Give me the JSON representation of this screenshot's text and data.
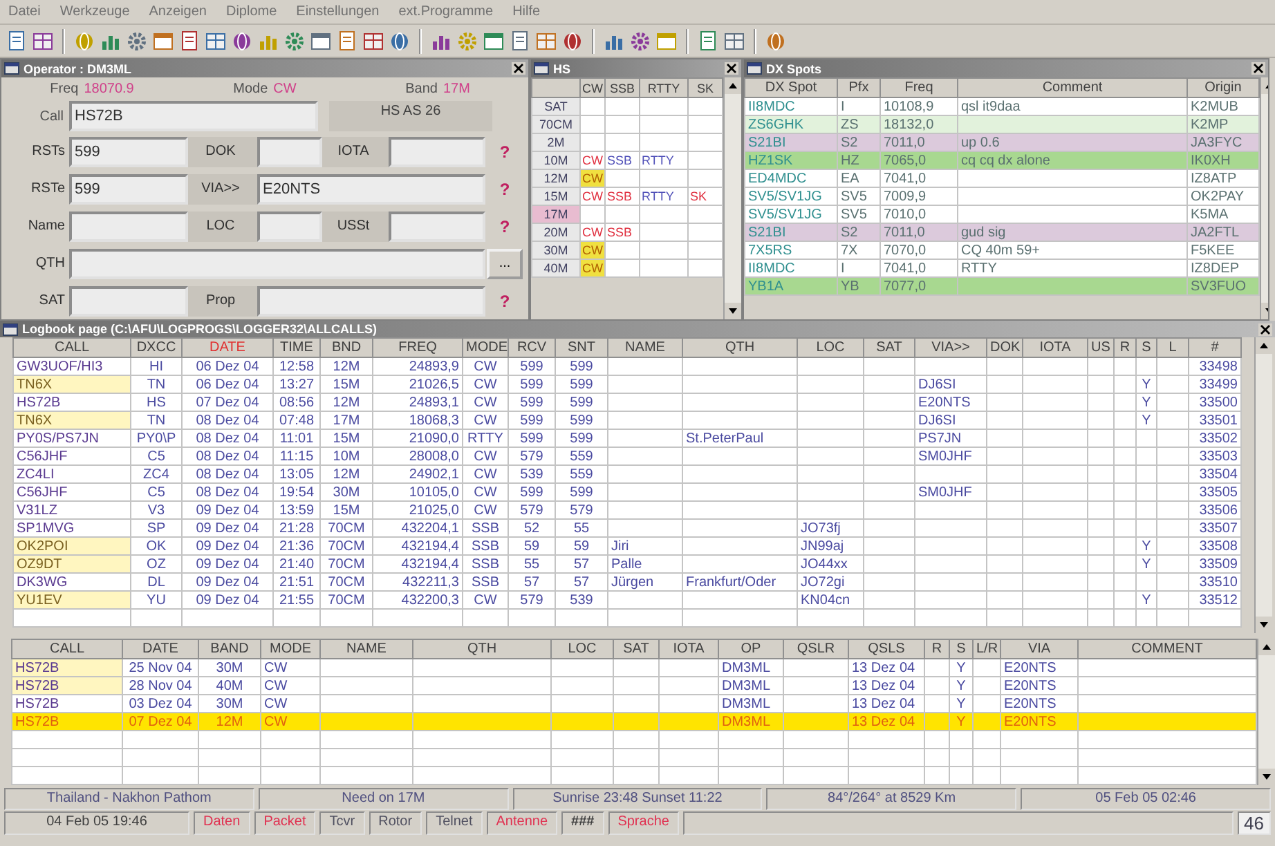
{
  "menu": [
    "Datei",
    "Werkzeuge",
    "Anzeigen",
    "Diplome",
    "Einstellungen",
    "ext.Programme",
    "Hilfe"
  ],
  "operator": {
    "title": "Operator : DM3ML",
    "status": [
      {
        "label": "Freq",
        "value": "18070.9"
      },
      {
        "label": "Mode",
        "value": "CW"
      },
      {
        "label": "Band",
        "value": "17M"
      }
    ],
    "call": {
      "label": "Call",
      "value": "HS72B"
    },
    "info": "HS AS 26",
    "rows": [
      {
        "fields": [
          {
            "label": "RSTs",
            "value": "599"
          },
          {
            "label": "DOK"
          },
          {
            "label": "IOTA"
          }
        ],
        "button": {
          "text": "?",
          "kind": "help"
        }
      },
      {
        "fields": [
          {
            "label": "RSTe",
            "value": "599"
          },
          {
            "label": "VIA>>",
            "value": "E20NTS"
          }
        ],
        "button": {
          "text": "?",
          "kind": "help"
        }
      },
      {
        "fields": [
          {
            "label": "Name"
          },
          {
            "label": "LOC"
          },
          {
            "label": "USSt"
          }
        ],
        "button": {
          "text": "?",
          "kind": "help"
        }
      },
      {
        "fields": [
          {
            "label": "QTH"
          }
        ],
        "button": {
          "text": "...",
          "kind": "browse"
        }
      },
      {
        "fields": [
          {
            "label": "SAT"
          },
          {
            "label": "Prop"
          }
        ],
        "button": {
          "text": "?",
          "kind": "help"
        }
      }
    ]
  },
  "hs": {
    "title": "HS",
    "columns": [
      "CW",
      "SSB",
      "RTTY",
      "SK"
    ],
    "rows": [
      {
        "band": "SAT",
        "selected": false
      },
      {
        "band": "70CM",
        "selected": false
      },
      {
        "band": "2M",
        "selected": false
      },
      {
        "band": "10M",
        "selected": false,
        "cw": {
          "text": "CW",
          "kind": "needed"
        },
        "ssb": {
          "text": "SSB",
          "kind": "worked"
        },
        "rtty": {
          "text": "RTTY",
          "kind": "worked"
        }
      },
      {
        "band": "12M",
        "selected": false,
        "cw": {
          "text": "CW",
          "kind": "confirmed"
        }
      },
      {
        "band": "15M",
        "selected": false,
        "cw": {
          "text": "CW",
          "kind": "needed"
        },
        "ssb": {
          "text": "SSB",
          "kind": "needed"
        },
        "rtty": {
          "text": "RTTY",
          "kind": "worked"
        },
        "psk": {
          "text": "SK",
          "kind": "needed"
        }
      },
      {
        "band": "17M",
        "selected": true
      },
      {
        "band": "20M",
        "selected": false,
        "cw": {
          "text": "CW",
          "kind": "needed"
        },
        "ssb": {
          "text": "SSB",
          "kind": "needed"
        }
      },
      {
        "band": "30M",
        "selected": false,
        "cw": {
          "text": "CW",
          "kind": "confirmed"
        }
      },
      {
        "band": "40M",
        "selected": false,
        "cw": {
          "text": "CW",
          "kind": "confirmed"
        }
      }
    ]
  },
  "dx_spots": {
    "title": "DX Spots",
    "columns": [
      "DX Spot",
      "Pfx",
      "Freq",
      "Comment",
      "Origin"
    ],
    "rows": [
      {
        "spot": "II8MDC",
        "pfx": "I",
        "freq": "10108,9",
        "comment": "qsl it9daa",
        "origin": "K2MUB",
        "color": "#ffffff"
      },
      {
        "spot": "ZS6GHK",
        "pfx": "ZS",
        "freq": "18132,0",
        "origin": "K2MP",
        "color": "#e2f2dc"
      },
      {
        "spot": "S21BI",
        "pfx": "S2",
        "freq": "7011,0",
        "comment": "up 0.6",
        "origin": "JA3FYC",
        "color": "#dccadc"
      },
      {
        "spot": "HZ1SK",
        "pfx": "HZ",
        "freq": "7065,0",
        "comment": "cq cq dx alone",
        "origin": "IK0XH",
        "color": "#a8d890"
      },
      {
        "spot": "ED4MDC",
        "pfx": "EA",
        "freq": "7041,0",
        "origin": "IZ8ATP",
        "color": "#ffffff"
      },
      {
        "spot": "SV5/SV1JG",
        "pfx": "SV5",
        "freq": "7009,9",
        "origin": "OK2PAY",
        "color": "#ffffff"
      },
      {
        "spot": "SV5/SV1JG",
        "pfx": "SV5",
        "freq": "7010,0",
        "origin": "K5MA",
        "color": "#ffffff"
      },
      {
        "spot": "S21BI",
        "pfx": "S2",
        "freq": "7011,0",
        "comment": "gud sig",
        "origin": "JA2FTL",
        "color": "#dccadc"
      },
      {
        "spot": "7X5RS",
        "pfx": "7X",
        "freq": "7070,0",
        "comment": "CQ 40m 59+",
        "origin": "F5KEE",
        "color": "#ffffff"
      },
      {
        "spot": "II8MDC",
        "pfx": "I",
        "freq": "7041,0",
        "comment": "RTTY",
        "origin": "IZ8DEP",
        "color": "#ffffff"
      },
      {
        "spot": "YB1A",
        "pfx": "YB",
        "freq": "7077,0",
        "origin": "SV3FUO",
        "color": "#a8d890"
      }
    ]
  },
  "logbook": {
    "title": "Logbook page (C:\\AFU\\LOGPROGS\\LOGGER32\\ALLCALLS)",
    "columns": [
      {
        "label": "CALL",
        "highlighted": false
      },
      {
        "label": "DXCC",
        "highlighted": false
      },
      {
        "label": "DATE",
        "highlighted": true
      },
      {
        "label": "TIME",
        "highlighted": false
      },
      {
        "label": "BND",
        "highlighted": false
      },
      {
        "label": "FREQ",
        "highlighted": false
      },
      {
        "label": "MODE",
        "highlighted": false
      },
      {
        "label": "RCV",
        "highlighted": false
      },
      {
        "label": "SNT",
        "highlighted": false
      },
      {
        "label": "NAME",
        "highlighted": false
      },
      {
        "label": "QTH",
        "highlighted": false
      },
      {
        "label": "LOC",
        "highlighted": false
      },
      {
        "label": "SAT",
        "highlighted": false
      },
      {
        "label": "VIA>>",
        "highlighted": false
      },
      {
        "label": "DOK",
        "highlighted": false
      },
      {
        "label": "IOTA",
        "highlighted": false
      },
      {
        "label": "US",
        "highlighted": false
      },
      {
        "label": "R",
        "highlighted": false
      },
      {
        "label": "S",
        "highlighted": false
      },
      {
        "label": "L",
        "highlighted": false
      },
      {
        "label": "#",
        "highlighted": false
      }
    ],
    "rows": [
      {
        "highlight": false,
        "call": "GW3UOF/HI3",
        "dxcc": "HI",
        "date": "06 Dez 04",
        "time": "12:58",
        "band": "12M",
        "freq": "24893,9",
        "mode": "CW",
        "rcv": "599",
        "snt": "599",
        "number": "33498"
      },
      {
        "highlight": true,
        "call": "TN6X",
        "dxcc": "TN",
        "date": "06 Dez 04",
        "time": "13:27",
        "band": "15M",
        "freq": "21026,5",
        "mode": "CW",
        "rcv": "599",
        "snt": "599",
        "via": "DJ6SI",
        "s": "Y",
        "number": "33499"
      },
      {
        "highlight": false,
        "call": "HS72B",
        "dxcc": "HS",
        "date": "07 Dez 04",
        "time": "08:56",
        "band": "12M",
        "freq": "24893,1",
        "mode": "CW",
        "rcv": "599",
        "snt": "599",
        "via": "E20NTS",
        "s": "Y",
        "number": "33500"
      },
      {
        "highlight": true,
        "call": "TN6X",
        "dxcc": "TN",
        "date": "08 Dez 04",
        "time": "07:48",
        "band": "17M",
        "freq": "18068,3",
        "mode": "CW",
        "rcv": "599",
        "snt": "599",
        "via": "DJ6SI",
        "s": "Y",
        "number": "33501"
      },
      {
        "highlight": false,
        "call": "PY0S/PS7JN",
        "dxcc": "PY0\\P",
        "date": "08 Dez 04",
        "time": "11:01",
        "band": "15M",
        "freq": "21090,0",
        "mode": "RTTY",
        "rcv": "599",
        "snt": "599",
        "qth": "St.PeterPaul",
        "via": "PS7JN",
        "number": "33502"
      },
      {
        "highlight": false,
        "call": "C56JHF",
        "dxcc": "C5",
        "date": "08 Dez 04",
        "time": "11:15",
        "band": "10M",
        "freq": "28008,0",
        "mode": "CW",
        "rcv": "579",
        "snt": "559",
        "via": "SM0JHF",
        "number": "33503"
      },
      {
        "highlight": false,
        "call": "ZC4LI",
        "dxcc": "ZC4",
        "date": "08 Dez 04",
        "time": "13:05",
        "band": "12M",
        "freq": "24902,1",
        "mode": "CW",
        "rcv": "539",
        "snt": "559",
        "number": "33504"
      },
      {
        "highlight": false,
        "call": "C56JHF",
        "dxcc": "C5",
        "date": "08 Dez 04",
        "time": "19:54",
        "band": "30M",
        "freq": "10105,0",
        "mode": "CW",
        "rcv": "599",
        "snt": "599",
        "via": "SM0JHF",
        "number": "33505"
      },
      {
        "highlight": false,
        "call": "V31LZ",
        "dxcc": "V3",
        "date": "09 Dez 04",
        "time": "13:59",
        "band": "15M",
        "freq": "21025,0",
        "mode": "CW",
        "rcv": "579",
        "snt": "579",
        "number": "33506"
      },
      {
        "highlight": false,
        "call": "SP1MVG",
        "dxcc": "SP",
        "date": "09 Dez 04",
        "time": "21:28",
        "band": "70CM",
        "freq": "432204,1",
        "mode": "SSB",
        "rcv": "52",
        "snt": "55",
        "loc": "JO73fj",
        "number": "33507"
      },
      {
        "highlight": true,
        "call": "OK2POI",
        "dxcc": "OK",
        "date": "09 Dez 04",
        "time": "21:36",
        "band": "70CM",
        "freq": "432194,4",
        "mode": "SSB",
        "rcv": "59",
        "snt": "59",
        "name": "Jiri",
        "loc": "JN99aj",
        "s": "Y",
        "number": "33508"
      },
      {
        "highlight": true,
        "call": "OZ9DT",
        "dxcc": "OZ",
        "date": "09 Dez 04",
        "time": "21:40",
        "band": "70CM",
        "freq": "432194,4",
        "mode": "SSB",
        "rcv": "55",
        "snt": "57",
        "name": "Palle",
        "loc": "JO44xx",
        "s": "Y",
        "number": "33509"
      },
      {
        "highlight": false,
        "call": "DK3WG",
        "dxcc": "DL",
        "date": "09 Dez 04",
        "time": "21:51",
        "band": "70CM",
        "freq": "432211,3",
        "mode": "SSB",
        "rcv": "57",
        "snt": "57",
        "name": "Jürgen",
        "qth": "Frankfurt/Oder",
        "loc": "JO72gi",
        "number": "33510"
      },
      {
        "highlight": true,
        "call": "YU1EV",
        "dxcc": "YU",
        "date": "09 Dez 04",
        "time": "21:55",
        "band": "70CM",
        "freq": "432200,3",
        "mode": "CW",
        "rcv": "579",
        "snt": "539",
        "loc": "KN04cn",
        "s": "Y",
        "number": "33512"
      }
    ]
  },
  "qso_history": {
    "columns": [
      "CALL",
      "DATE",
      "BAND",
      "MODE",
      "NAME",
      "QTH",
      "LOC",
      "SAT",
      "IOTA",
      "OP",
      "QSLR",
      "QSLS",
      "R",
      "S",
      "L/R",
      "VIA",
      "COMMENT"
    ],
    "rows": [
      {
        "selected": false,
        "highlight": true,
        "call": "HS72B",
        "date": "25 Nov 04",
        "band": "30M",
        "mode": "CW",
        "op": "DM3ML",
        "qsls": "13 Dez 04",
        "s": "Y",
        "via": "E20NTS"
      },
      {
        "selected": false,
        "highlight": true,
        "call": "HS72B",
        "date": "28 Nov 04",
        "band": "40M",
        "mode": "CW",
        "op": "DM3ML",
        "qsls": "13 Dez 04",
        "s": "Y",
        "via": "E20NTS"
      },
      {
        "selected": false,
        "highlight": false,
        "call": "HS72B",
        "date": "03 Dez 04",
        "band": "30M",
        "mode": "CW",
        "op": "DM3ML",
        "qsls": "13 Dez 04",
        "s": "Y",
        "via": "E20NTS"
      },
      {
        "selected": true,
        "highlight": false,
        "call": "HS72B",
        "date": "07 Dez 04",
        "band": "12M",
        "mode": "CW",
        "op": "DM3ML",
        "qsls": "13 Dez 04",
        "s": "Y",
        "via": "E20NTS"
      }
    ]
  },
  "status_bar": {
    "info": [
      "Thailand - Nakhon Pathom",
      "Need on 17M",
      "Sunrise 23:48 Sunset 11:22",
      "84°/264° at 8529 Km",
      "05 Feb 05 02:46"
    ],
    "items": [
      {
        "text": "04 Feb 05 19:46",
        "kind": "text"
      },
      {
        "text": "Daten",
        "kind": "alert"
      },
      {
        "text": "Packet",
        "kind": "alert"
      },
      {
        "text": "Tcvr",
        "kind": "normal"
      },
      {
        "text": "Rotor",
        "kind": "normal"
      },
      {
        "text": "Telnet",
        "kind": "normal"
      },
      {
        "text": "Antenne",
        "kind": "alert"
      },
      {
        "text": "###",
        "kind": "bold"
      },
      {
        "text": "Sprache",
        "kind": "alert"
      }
    ],
    "corner": "46"
  }
}
